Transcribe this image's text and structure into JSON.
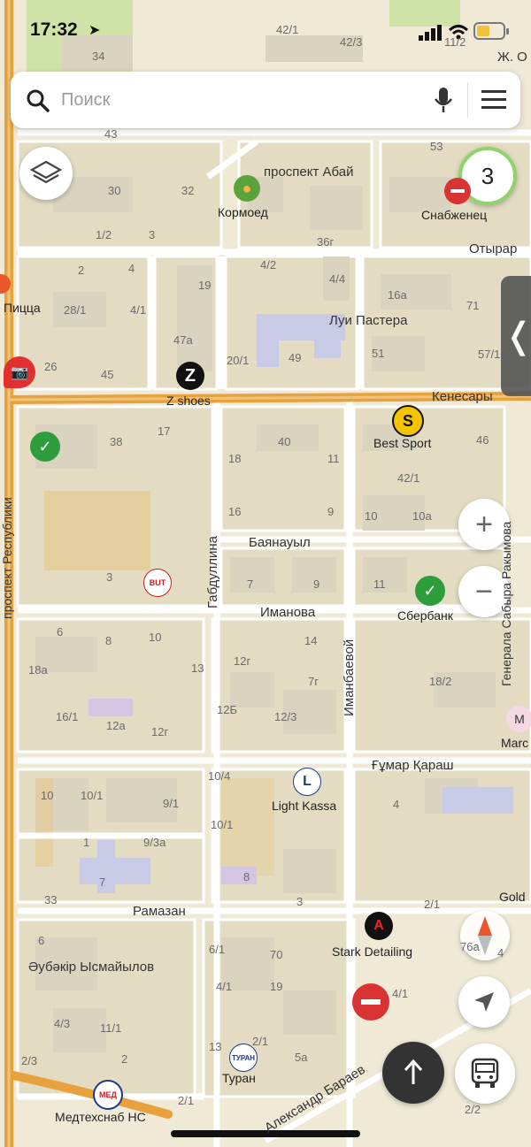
{
  "status": {
    "time": "17:32"
  },
  "search": {
    "placeholder": "Поиск"
  },
  "controls": {
    "layers_badge": "3",
    "zoom_in": "+",
    "zoom_out": "−"
  },
  "colors": {
    "major_road": "#e8a23d",
    "block": "#e0d9bf",
    "building": "#d6d0bd",
    "background": "#efe9d6",
    "park": "#cfe3a8"
  },
  "streets": [
    "проспект Абай",
    "Отырар",
    "Луи Пастера",
    "Кенесары",
    "Баянауыл",
    "Иманова",
    "Габдуллина",
    "Иманбаевой",
    "Ғұмар Қараш",
    "Рамазан",
    "Әубәкір Ысмайылов",
    "Александр Бараев",
    "проспект Республики",
    "Генерала Сабыра Ракымова",
    "Ж. О"
  ],
  "pois": [
    "Кормоед",
    "Снабженец",
    "Z shoes",
    "Best Sport",
    "Сбербанк",
    "Light Kassa",
    "Stark Detailing",
    "Туран",
    "Медтехснаб НС",
    "Gold",
    "Marc",
    "Пицца"
  ],
  "house_numbers": [
    "34",
    "42/1",
    "42/3",
    "11/2",
    "43",
    "53",
    "30",
    "32",
    "1/2",
    "3",
    "36г",
    "2",
    "4",
    "19",
    "4/2",
    "4/4",
    "16а",
    "71",
    "28/1",
    "4/1",
    "47а",
    "49",
    "51",
    "57/1",
    "20/1",
    "26",
    "45",
    "38",
    "17",
    "40",
    "46",
    "18",
    "11",
    "42/1",
    "16",
    "9",
    "10",
    "10а",
    "3",
    "7",
    "9",
    "11",
    "6",
    "8",
    "10",
    "14",
    "18а",
    "13",
    "12г",
    "7г",
    "18/2",
    "16/1",
    "12а",
    "12г",
    "12Б",
    "12/3",
    "10/4",
    "10",
    "10/1",
    "9/1",
    "10/1",
    "4",
    "1",
    "9/3а",
    "7",
    "8",
    "33",
    "3",
    "2/1",
    "6",
    "6/1",
    "70",
    "76а",
    "4",
    "4/1",
    "19",
    "4/1",
    "4/3",
    "11/1",
    "2/1",
    "2/3",
    "2",
    "13",
    "5а",
    "2/1",
    "2/2"
  ]
}
